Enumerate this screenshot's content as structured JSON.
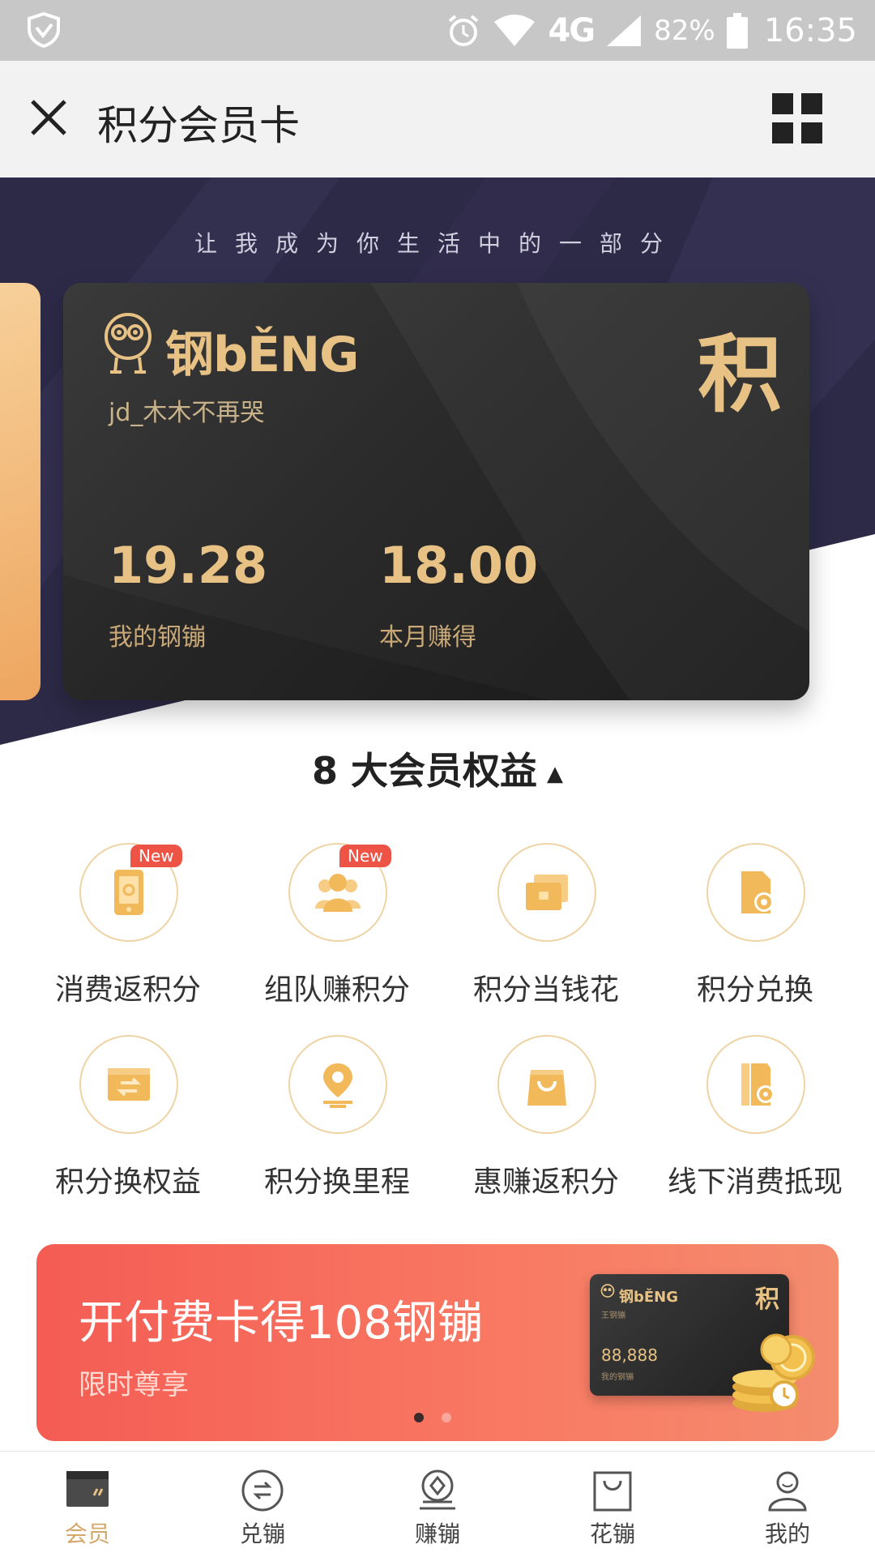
{
  "status_bar": {
    "network": "4G",
    "battery": "82%",
    "time": "16:35"
  },
  "header": {
    "title": "积分会员卡"
  },
  "hero": {
    "slogan": "让我成为你生活中的一部分"
  },
  "card": {
    "brand": "钢bĚNG",
    "user": "jd_木木不再哭",
    "badge": "积",
    "stats": [
      {
        "value": "19.28",
        "label": "我的钢镚"
      },
      {
        "value": "18.00",
        "label": "本月赚得"
      }
    ]
  },
  "benefits": {
    "title": "8 大会员权益",
    "arrow": "▲",
    "new_badge": "New",
    "items": [
      {
        "label": "消费返积分",
        "icon": "phone-icon"
      },
      {
        "label": "组队赚积分",
        "icon": "group-icon"
      },
      {
        "label": "积分当钱花",
        "icon": "wallet-icon"
      },
      {
        "label": "积分兑换",
        "icon": "exchange-icon"
      },
      {
        "label": "积分换权益",
        "icon": "transfer-card-icon"
      },
      {
        "label": "积分换里程",
        "icon": "location-pin-icon"
      },
      {
        "label": "惠赚返积分",
        "icon": "shopping-bag-icon"
      },
      {
        "label": "线下消费抵现",
        "icon": "offline-coupon-icon"
      }
    ]
  },
  "promo": {
    "title": "开付费卡得108钢镚",
    "subtitle": "限时尊享",
    "card_brand": "钢bĚNG",
    "card_user": "王钢镚",
    "card_badge": "积",
    "card_value": "88,888",
    "card_value_label": "我的钢镚",
    "active_slide": 1,
    "slide_count": 2
  },
  "bottom_nav": {
    "items": [
      {
        "label": "会员",
        "icon": "member-card-icon",
        "active": true
      },
      {
        "label": "兑镚",
        "icon": "exchange-coin-icon",
        "active": false
      },
      {
        "label": "赚镚",
        "icon": "earn-coin-icon",
        "active": false
      },
      {
        "label": "花镚",
        "icon": "spend-bag-icon",
        "active": false
      },
      {
        "label": "我的",
        "icon": "profile-icon",
        "active": false
      }
    ]
  },
  "colors": {
    "gold": "#e8c285",
    "accent": "#d4a86a",
    "promo_red": "#f45c54",
    "badge_red": "#ee5445",
    "hero_dark": "#2d2a48"
  }
}
